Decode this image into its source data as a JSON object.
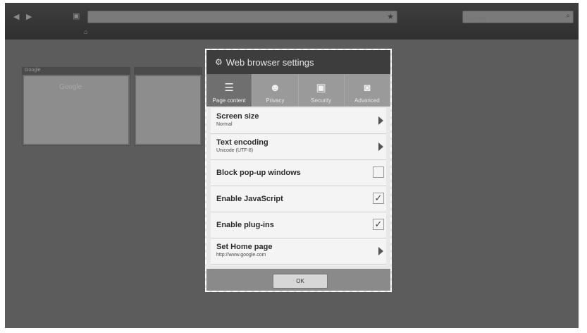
{
  "dialog": {
    "title": "Web browser settings",
    "tabs": [
      {
        "label": "Page content",
        "icon": "page-content-icon"
      },
      {
        "label": "Privacy",
        "icon": "person-icon"
      },
      {
        "label": "Security",
        "icon": "lock-icon"
      },
      {
        "label": "Advanced",
        "icon": "camera-icon"
      }
    ],
    "rows": [
      {
        "label": "Screen size",
        "sub": "Normal"
      },
      {
        "label": "Text encoding",
        "sub": "Unicode (UTF-8)"
      },
      {
        "label": "Block pop-up windows"
      },
      {
        "label": "Enable JavaScript"
      },
      {
        "label": "Enable plug-ins"
      },
      {
        "label": "Set Home page",
        "sub": "http://www.google.com"
      }
    ],
    "ok_label": "OK"
  },
  "browser": {
    "search_placeholder": "Google",
    "thumbnails": [
      {
        "title": "Google",
        "logo": "Google"
      },
      {
        "title": ""
      }
    ]
  }
}
